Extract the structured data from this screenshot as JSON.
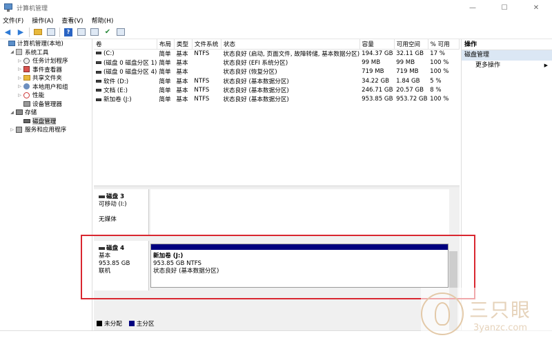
{
  "window": {
    "title": "计算机管理",
    "minimize": "—",
    "maximize": "☐",
    "close": "✕"
  },
  "menu": [
    "文件(F)",
    "操作(A)",
    "查看(V)",
    "帮助(H)"
  ],
  "tree": [
    {
      "label": "计算机管理(本地)",
      "indent": 0,
      "twisty": "",
      "icon": "computer-management-icon"
    },
    {
      "label": "系统工具",
      "indent": 1,
      "twisty": "◢",
      "icon": "system-tools-icon"
    },
    {
      "label": "任务计划程序",
      "indent": 2,
      "twisty": "▷",
      "icon": "task-scheduler-icon"
    },
    {
      "label": "事件查看器",
      "indent": 2,
      "twisty": "▷",
      "icon": "event-viewer-icon"
    },
    {
      "label": "共享文件夹",
      "indent": 2,
      "twisty": "▷",
      "icon": "shared-folders-icon"
    },
    {
      "label": "本地用户和组",
      "indent": 2,
      "twisty": "▷",
      "icon": "local-users-icon"
    },
    {
      "label": "性能",
      "indent": 2,
      "twisty": "▷",
      "icon": "performance-icon"
    },
    {
      "label": "设备管理器",
      "indent": 2,
      "twisty": "",
      "icon": "device-manager-icon"
    },
    {
      "label": "存储",
      "indent": 1,
      "twisty": "◢",
      "icon": "storage-icon"
    },
    {
      "label": "磁盘管理",
      "indent": 2,
      "twisty": "",
      "icon": "disk-management-icon",
      "selected": true
    },
    {
      "label": "服务和应用程序",
      "indent": 1,
      "twisty": "▷",
      "icon": "services-apps-icon"
    }
  ],
  "volumes": {
    "headers": [
      "卷",
      "布局",
      "类型",
      "文件系统",
      "状态",
      "容量",
      "可用空间",
      "% 可用"
    ],
    "rows": [
      [
        "(C:)",
        "简单",
        "基本",
        "NTFS",
        "状态良好 (启动, 页面文件, 故障转储, 基本数据分区)",
        "194.37 GB",
        "32.11 GB",
        "17 %"
      ],
      [
        "(磁盘 0 磁盘分区 1)",
        "简单",
        "基本",
        "",
        "状态良好 (EFI 系统分区)",
        "99 MB",
        "99 MB",
        "100 %"
      ],
      [
        "(磁盘 0 磁盘分区 4)",
        "简单",
        "基本",
        "",
        "状态良好 (恢复分区)",
        "719 MB",
        "719 MB",
        "100 %"
      ],
      [
        "软件 (D:)",
        "简单",
        "基本",
        "NTFS",
        "状态良好 (基本数据分区)",
        "34.22 GB",
        "1.84 GB",
        "5 %"
      ],
      [
        "文档 (E:)",
        "简单",
        "基本",
        "NTFS",
        "状态良好 (基本数据分区)",
        "246.71 GB",
        "20.57 GB",
        "8 %"
      ],
      [
        "新加卷 (J:)",
        "简单",
        "基本",
        "NTFS",
        "状态良好 (基本数据分区)",
        "953.85 GB",
        "953.72 GB",
        "100 %"
      ]
    ]
  },
  "disk3": {
    "title": "磁盘 3",
    "line1": "可移动 (I:)",
    "line2": "无媒体"
  },
  "disk4": {
    "title": "磁盘 4",
    "line1": "基本",
    "line2": "953.85 GB",
    "line3": "联机",
    "partition": {
      "name": "新加卷 (J:)",
      "size": "953.85 GB NTFS",
      "status": "状态良好 (基本数据分区)",
      "bar_color": "#00007f"
    }
  },
  "legend": [
    {
      "label": "未分配",
      "color": "#000000"
    },
    {
      "label": "主分区",
      "color": "#00007f"
    }
  ],
  "actions": {
    "header": "操作",
    "section": "磁盘管理",
    "more": "更多操作",
    "more_arrow": "▶"
  },
  "watermark": {
    "cn": "三只眼",
    "url": "3yanzc.com"
  }
}
